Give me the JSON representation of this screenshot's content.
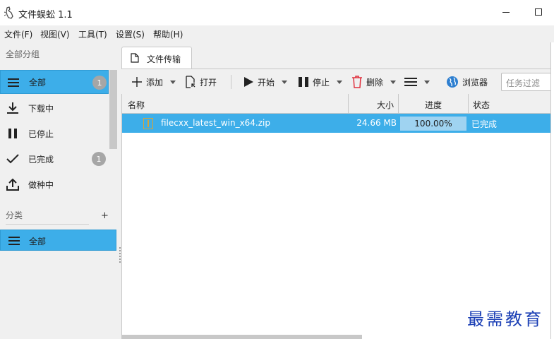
{
  "window": {
    "title": "文件蜈蚣 1.1"
  },
  "menu": [
    "文件(F)",
    "视图(V)",
    "工具(T)",
    "设置(S)",
    "帮助(H)"
  ],
  "sidebar": {
    "group_header": "全部分组",
    "items": [
      {
        "label": "全部",
        "badge": "1",
        "icon": "menu-lines-icon",
        "selected": true
      },
      {
        "label": "下载中",
        "icon": "download-icon"
      },
      {
        "label": "已停止",
        "icon": "pause-icon"
      },
      {
        "label": "已完成",
        "badge": "1",
        "icon": "check-icon"
      },
      {
        "label": "做种中",
        "icon": "upload-icon"
      }
    ],
    "category_header": "分类",
    "category_add": "+",
    "categories": [
      {
        "label": "全部",
        "selected": true
      }
    ]
  },
  "tabs": [
    {
      "label": "文件传输",
      "active": true
    }
  ],
  "toolbar": {
    "add": "添加",
    "open": "打开",
    "start": "开始",
    "stop": "停止",
    "delete": "删除",
    "browser": "浏览器",
    "filter_placeholder": "任务过滤"
  },
  "table": {
    "columns": {
      "name": "名称",
      "size": "大小",
      "progress": "进度",
      "status": "状态"
    },
    "rows": [
      {
        "name": "filecxx_latest_win_x64.zip",
        "size": "24.66 MB",
        "progress_text": "100.00%",
        "progress": 1.0,
        "status": "已完成"
      }
    ]
  },
  "watermark": "最需教育",
  "colors": {
    "accent": "#3daee9",
    "progress_fill": "#9fd3f1",
    "delete": "#e0303d",
    "browser": "#2e7fd0",
    "watermark": "#1b3fb5"
  }
}
